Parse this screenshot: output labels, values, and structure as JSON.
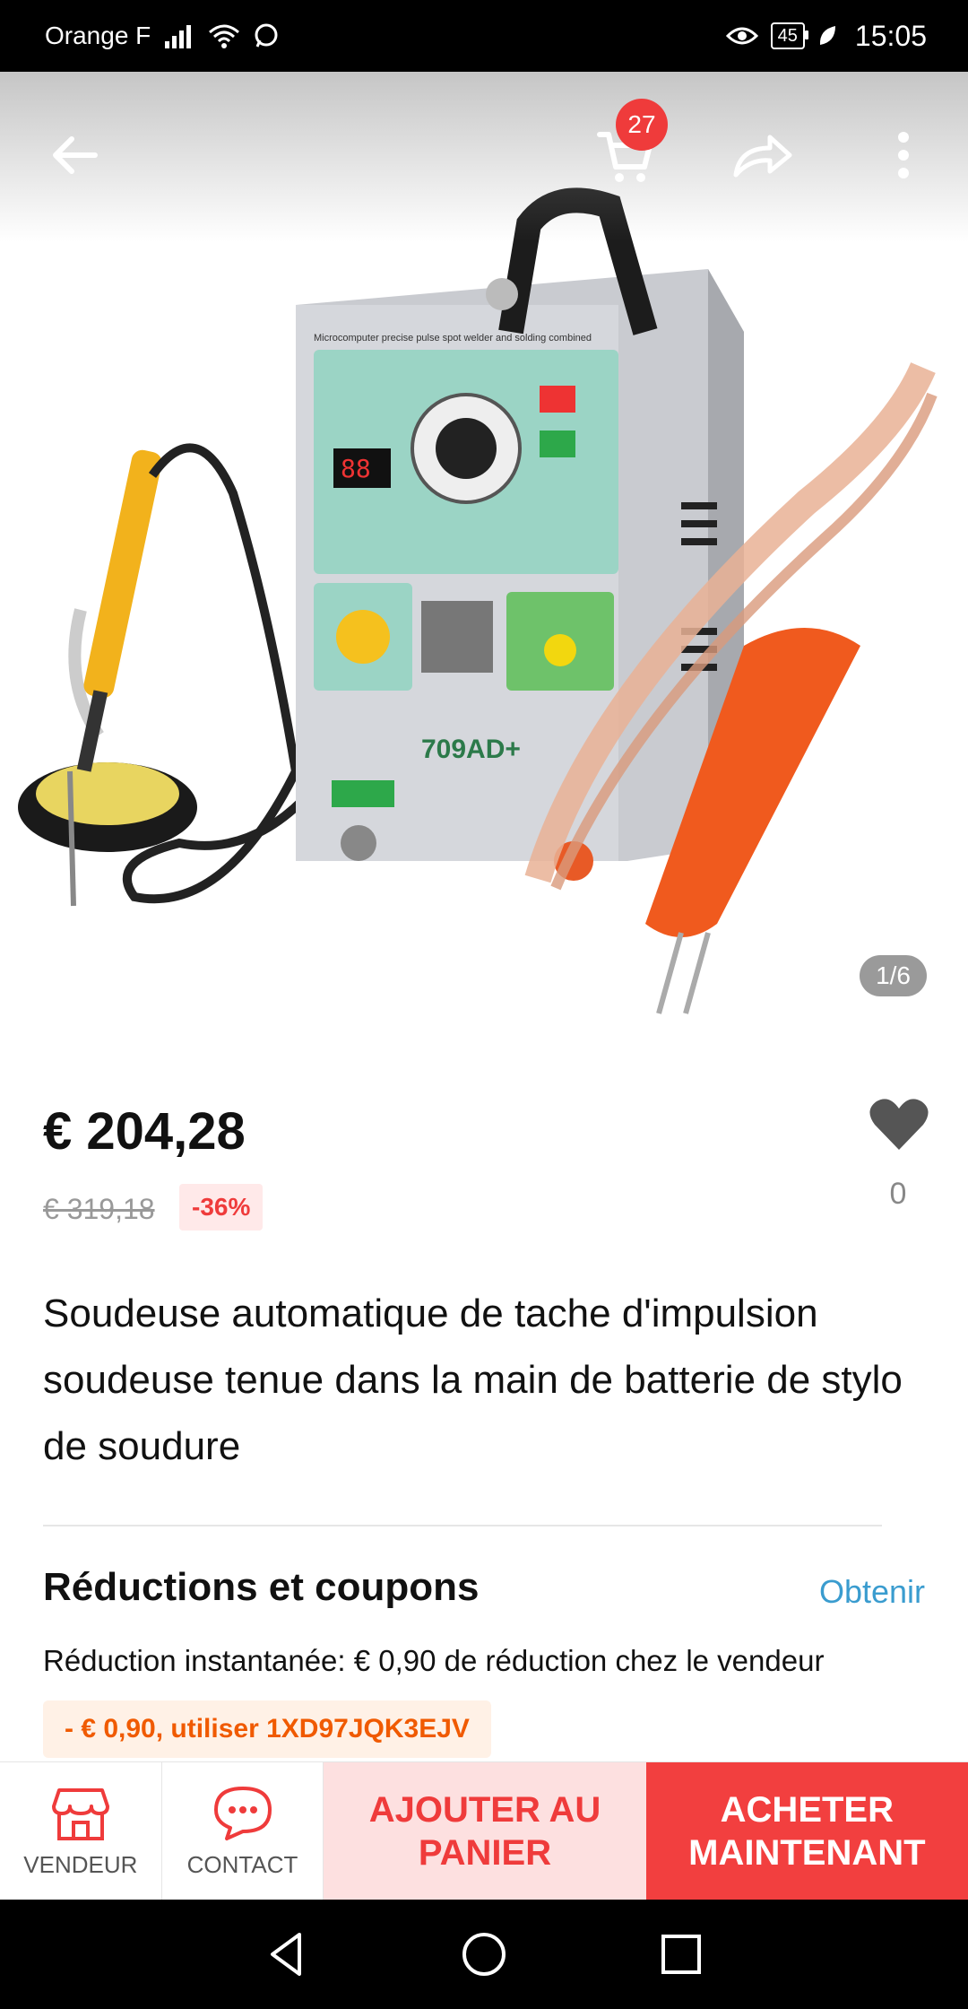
{
  "status_bar": {
    "carrier": "Orange F",
    "battery": "45",
    "time": "15:05"
  },
  "product_header": {
    "cart_count": "27",
    "image_counter": "1/6"
  },
  "product": {
    "price": "€ 204,28",
    "original_price": "€ 319,18",
    "discount": "-36%",
    "wishlist_count": "0",
    "title": "Soudeuse automatique de tache d'impulsion soudeuse tenue dans la main de batterie de stylo de soudure",
    "device_label": "Microcomputer precise pulse spot welder and solding combined",
    "model": "709AD+"
  },
  "coupons": {
    "heading": "Réductions et coupons",
    "link": "Obtenir",
    "description": "Réduction instantanée: € 0,90 de réduction chez le vendeur",
    "code": "- € 0,90,  utiliser 1XD97JQK3EJV"
  },
  "action_bar": {
    "seller_label": "VENDEUR",
    "contact_label": "CONTACT",
    "add_to_cart": "AJOUTER AU PANIER",
    "buy_now": "ACHETER MAINTENANT"
  },
  "colors": {
    "accent_red": "#ef3b3b",
    "link_blue": "#3a9ccf",
    "coupon_orange": "#f05a00"
  }
}
